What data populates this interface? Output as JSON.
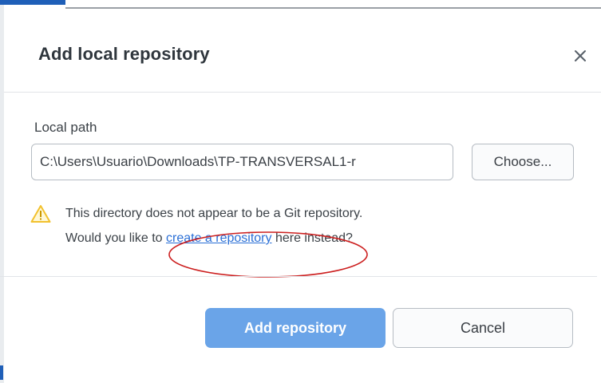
{
  "dialog": {
    "title": "Add local repository",
    "close_icon": "close-icon",
    "local_path": {
      "label": "Local path",
      "value": "C:\\Users\\Usuario\\Downloads\\TP-TRANSVERSAL1-r",
      "choose_label": "Choose..."
    },
    "warning": {
      "icon": "warning-icon",
      "icon_color": "#f2c12e",
      "line1": "This directory does not appear to be a Git repository.",
      "line2_before": "Would you like to ",
      "link": "create a repository",
      "line2_after": " here instead?"
    },
    "annotation": {
      "shape": "ellipse",
      "color": "#cc1f1f"
    },
    "footer": {
      "add_label": "Add repository",
      "add_disabled": true,
      "cancel_label": "Cancel"
    }
  },
  "colors": {
    "primary_button": "#6aa4e8",
    "link": "#2a6fd6",
    "accent": "#1f5fb8"
  }
}
